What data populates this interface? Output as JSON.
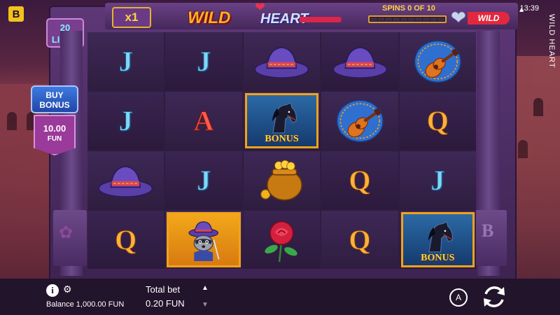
{
  "brand_logo_letter": "B",
  "status": {
    "time": "13:39",
    "speaker_icon": "speaker-icon"
  },
  "game": {
    "vertical_title": "WILD HEART",
    "logo_word1": "WILD",
    "logo_word2": "HEART",
    "multiplier": "x1",
    "lines_count": "20",
    "lines_label": "LINES",
    "spins_text": "SPINS 0 OF 10",
    "spins_total": 10,
    "spins_done": 0,
    "wild_label": "WILD"
  },
  "buy_bonus": {
    "label_line1": "BUY",
    "label_line2": "BONUS",
    "price": "10.00",
    "currency": "FUN"
  },
  "reels": [
    [
      "J",
      "J",
      "hat",
      "hat",
      "guitar"
    ],
    [
      "J",
      "A",
      "bonus",
      "guitar",
      "Q"
    ],
    [
      "hat",
      "J",
      "gold-pot",
      "Q",
      "J"
    ],
    [
      "Q",
      "raccoon",
      "rose",
      "Q",
      "bonus"
    ]
  ],
  "bonus_label": "BONUS",
  "bottom_bar": {
    "balance": "Balance 1,000.00 FUN",
    "total_bet_label": "Total bet",
    "total_bet_value": "0.20 FUN",
    "auto_label": "A",
    "up_arrow": "▲",
    "down_arrow": "▼"
  },
  "colors": {
    "accent_gold": "#f2a21a",
    "wild_red": "#e1283e",
    "spins_yellow": "#ffd23c"
  }
}
